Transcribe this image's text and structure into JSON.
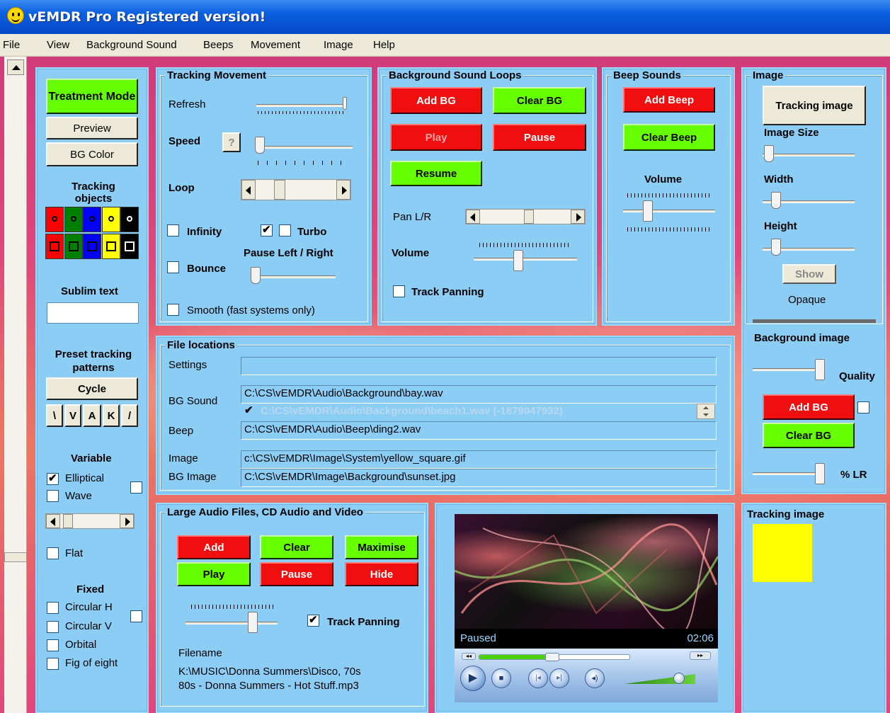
{
  "app": {
    "title": "vEMDR Pro Registered version!"
  },
  "menu": [
    "File",
    "View",
    "Background Sound",
    "Beeps",
    "Movement",
    "Image",
    "Help"
  ],
  "left": {
    "treatment": "Treatment Mode",
    "preview": "Preview",
    "bgcolor": "BG Color",
    "tracking_objects": "Tracking objects",
    "sublim": "Sublim text",
    "preset": "Preset tracking patterns",
    "cycle": "Cycle",
    "patterns": [
      "\\",
      "V",
      "A",
      "K",
      "/"
    ],
    "variable": "Variable",
    "elliptical": "Elliptical",
    "wave": "Wave",
    "flat": "Flat",
    "fixed": "Fixed",
    "circH": "Circular H",
    "circV": "Circular V",
    "orbital": "Orbital",
    "fig8": "Fig of eight",
    "colors": [
      "#ff0000",
      "#008000",
      "#0000ff",
      "#ffff00",
      "#000000"
    ]
  },
  "tracking": {
    "legend": "Tracking Movement",
    "refresh": "Refresh",
    "speed": "Speed",
    "help": "?",
    "loop": "Loop",
    "infinity": "Infinity",
    "turbo": "Turbo",
    "pause_lr": "Pause Left / Right",
    "bounce": "Bounce",
    "smooth": "Smooth (fast systems only)"
  },
  "bgloops": {
    "legend": "Background Sound Loops",
    "add": "Add BG",
    "clear": "Clear BG",
    "play": "Play",
    "pause": "Pause",
    "resume": "Resume",
    "pan": "Pan L/R",
    "volume": "Volume",
    "track_panning": "Track Panning"
  },
  "beeps": {
    "legend": "Beep Sounds",
    "add": "Add Beep",
    "clear": "Clear Beep",
    "volume": "Volume"
  },
  "image": {
    "legend": "Image",
    "tracking_image": "Tracking image",
    "size": "Image Size",
    "width": "Width",
    "height": "Height",
    "show": "Show",
    "opaque": "Opaque",
    "bg_image": "Background image",
    "quality": "Quality",
    "add": "Add BG",
    "clear": "Clear BG",
    "lr": "% LR"
  },
  "files": {
    "legend": "File locations",
    "settings": "Settings",
    "settings_val": "",
    "bgsound": "BG Sound",
    "bgsound_val": "C:\\CS\\vEMDR\\Audio\\Background\\bay.wav",
    "bgsound2": "C:\\CS\\vEMDR\\Audio\\Background\\beach1.wav (-1879047932)",
    "beep": "Beep",
    "beep_val": "C:\\CS\\vEMDR\\Audio\\Beep\\ding2.wav",
    "image": "Image",
    "image_val": "c:\\CS\\vEMDR\\Image\\System\\yellow_square.gif",
    "bgimage": "BG Image",
    "bgimage_val": "C:\\CS\\vEMDR\\Image\\Background\\sunset.jpg"
  },
  "large": {
    "legend": "Large Audio Files, CD Audio and Video",
    "add": "Add",
    "clear": "Clear",
    "maximise": "Maximise",
    "play": "Play",
    "pause": "Pause",
    "hide": "Hide",
    "track_panning": "Track Panning",
    "filename": "Filename",
    "path1": "K:\\MUSIC\\Donna Summers\\Disco, 70s",
    "path2": "80s - Donna Summers - Hot Stuff.mp3"
  },
  "player": {
    "status": "Paused",
    "time": "02:06",
    "progress": 0.45,
    "volume": 0.75
  },
  "tracking_preview": {
    "legend": "Tracking image",
    "color": "#ffff00"
  }
}
